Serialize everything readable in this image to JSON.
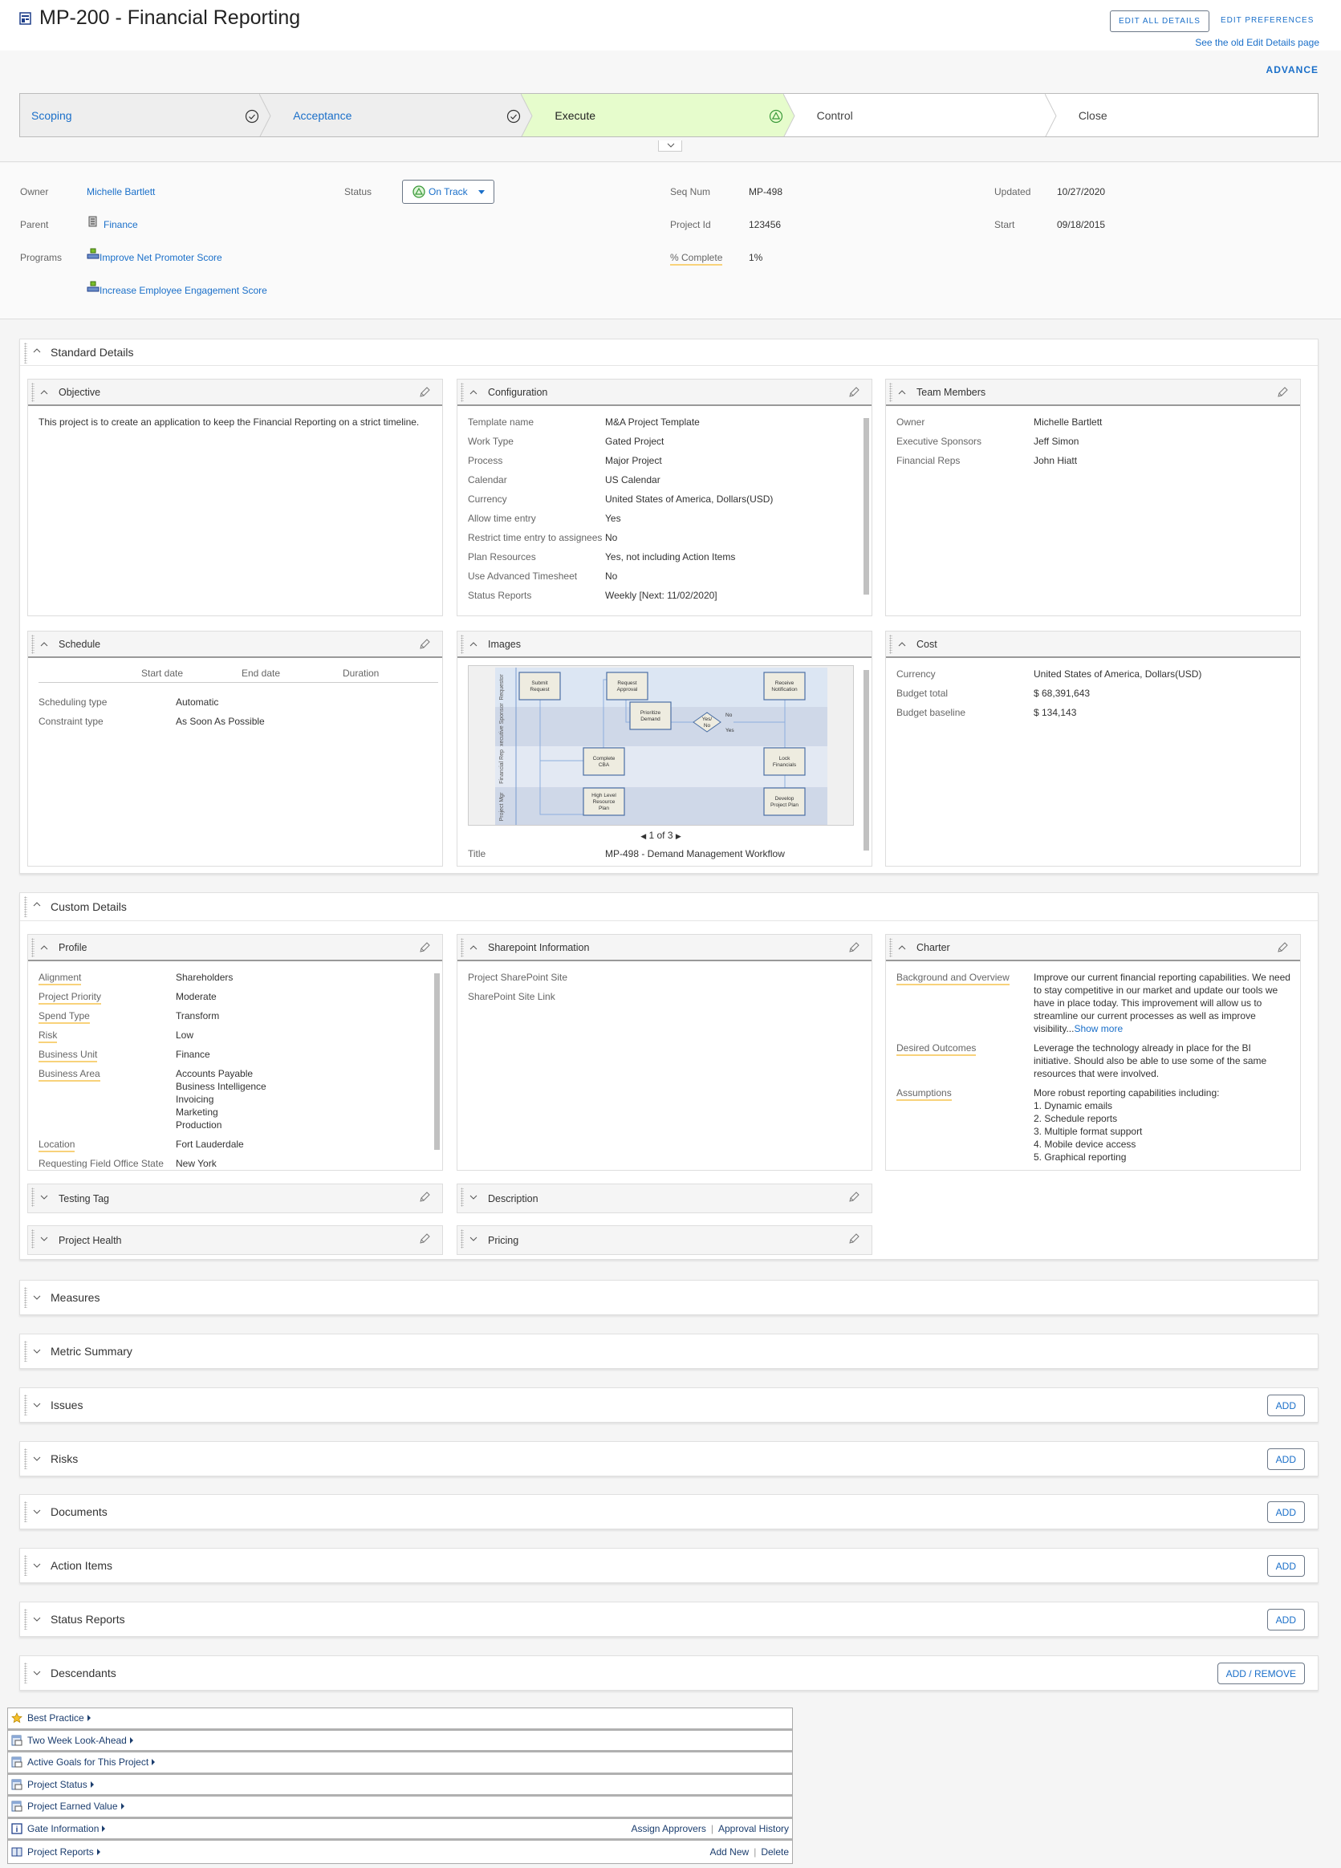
{
  "header": {
    "title": "MP-200 - Financial Reporting",
    "edit_all": "EDIT ALL DETAILS",
    "edit_prefs": "EDIT PREFERENCES",
    "old_page": "See the old Edit Details page",
    "advance": "ADVANCE"
  },
  "stages": [
    {
      "label": "Scoping",
      "state": "complete"
    },
    {
      "label": "Acceptance",
      "state": "complete"
    },
    {
      "label": "Execute",
      "state": "current"
    },
    {
      "label": "Control",
      "state": "future"
    },
    {
      "label": "Close",
      "state": "future"
    }
  ],
  "info": {
    "owner_label": "Owner",
    "owner": "Michelle Bartlett",
    "parent_label": "Parent",
    "parent": "Finance",
    "programs_label": "Programs",
    "programs": [
      "Improve Net Promoter Score",
      "Increase Employee Engagement Score"
    ],
    "status_label": "Status",
    "status": "On Track",
    "seq_label": "Seq Num",
    "seq": "MP-498",
    "projid_label": "Project Id",
    "projid": "123456",
    "pct_label": "% Complete",
    "pct": "1%",
    "updated_label": "Updated",
    "updated": "10/27/2020",
    "start_label": "Start",
    "start": "09/18/2015"
  },
  "standard": {
    "title": "Standard Details",
    "objective": {
      "title": "Objective",
      "text": "This project is to create an application to keep the Financial Reporting on a strict timeline."
    },
    "configuration": {
      "title": "Configuration",
      "rows": [
        {
          "k": "Template name",
          "v": "M&A Project Template"
        },
        {
          "k": "Work Type",
          "v": "Gated Project"
        },
        {
          "k": "Process",
          "v": "Major Project"
        },
        {
          "k": "Calendar",
          "v": "US Calendar",
          "link": true
        },
        {
          "k": "Currency",
          "v": "United States of America, Dollars(USD)"
        },
        {
          "k": "Allow time entry",
          "v": "Yes"
        },
        {
          "k": "Restrict time entry to assignees",
          "v": "No"
        },
        {
          "k": "Plan Resources",
          "v": "Yes, not including Action Items"
        },
        {
          "k": "Use Advanced Timesheet",
          "v": "No"
        },
        {
          "k": "Status Reports",
          "v": "Weekly [Next: 11/02/2020]"
        }
      ]
    },
    "team": {
      "title": "Team Members",
      "rows": [
        {
          "k": "Owner",
          "v": "Michelle Bartlett",
          "link": true
        },
        {
          "k": "Executive Sponsors",
          "v": "Jeff Simon",
          "link": true
        },
        {
          "k": "Financial Reps",
          "v": "John Hiatt",
          "link": true
        }
      ]
    },
    "schedule": {
      "title": "Schedule",
      "columns": [
        "Start date",
        "End date",
        "Duration"
      ],
      "rows": [
        {
          "k": "Scheduling type",
          "v": "Automatic"
        },
        {
          "k": "Constraint type",
          "v": "As Soon As Possible"
        }
      ]
    },
    "images": {
      "title": "Images",
      "pager": "1 of 3",
      "title_label": "Title",
      "title_value": "MP-498 - Demand Management Workflow",
      "lanes": [
        "Requestor",
        "Executive Sponsor",
        "Financial Rep",
        "Project Mgr"
      ],
      "nodes": [
        "Submit Request",
        "Request Approval",
        "Receive Notification",
        "Prioritize Demand",
        "Yes/ No",
        "Complete CBA",
        "Lock Financials",
        "High Level Resource Plan",
        "Develop Project Plan"
      ],
      "edge_labels": [
        "No",
        "Yes"
      ]
    },
    "cost": {
      "title": "Cost",
      "rows": [
        {
          "k": "Currency",
          "v": "United States of America, Dollars(USD)"
        },
        {
          "k": "Budget total",
          "v": "$ 68,391,643"
        },
        {
          "k": "Budget baseline",
          "v": "$ 134,143"
        }
      ]
    }
  },
  "custom": {
    "title": "Custom Details",
    "profile": {
      "title": "Profile",
      "rows": [
        {
          "k": "Alignment",
          "v": "Shareholders",
          "u": true
        },
        {
          "k": "Project Priority",
          "v": "Moderate",
          "u": true
        },
        {
          "k": "Spend Type",
          "v": "Transform",
          "u": true
        },
        {
          "k": "Risk",
          "v": "Low",
          "u": true
        },
        {
          "k": "Business Unit",
          "v": "Finance",
          "u": true
        },
        {
          "k": "Business Area",
          "v": "Accounts Payable\nBusiness Intelligence\nInvoicing\nMarketing\nProduction",
          "u": true
        },
        {
          "k": "Location",
          "v": "Fort Lauderdale",
          "u": true
        },
        {
          "k": "Requesting Field Office State",
          "v": "New York"
        }
      ]
    },
    "sharepoint": {
      "title": "Sharepoint Information",
      "rows": [
        {
          "k": "Project SharePoint Site",
          "v": ""
        },
        {
          "k": "SharePoint Site Link",
          "v": ""
        }
      ]
    },
    "charter": {
      "title": "Charter",
      "show_more": "Show more",
      "rows": [
        {
          "k": "Background and Overview",
          "v": "Improve our current financial reporting capabilities. We need to stay competitive in our market and update our tools we have in place today. This improvement will allow us to streamline our current processes as well as improve visibility...",
          "u": true,
          "more": true
        },
        {
          "k": "Desired Outcomes",
          "v": "Leverage the technology already in place for the BI initiative. Should also be able to use some of the same resources that were involved.",
          "u": true
        },
        {
          "k": "Assumptions",
          "v": "More robust reporting capabilities including:\n1. Dynamic emails\n2. Schedule reports\n3. Multiple format support\n4. Mobile device access\n5. Graphical reporting",
          "u": true
        }
      ]
    },
    "collapsed": [
      "Testing Tag",
      "Description",
      "Project Health",
      "Pricing"
    ]
  },
  "sections": [
    {
      "title": "Measures"
    },
    {
      "title": "Metric Summary"
    },
    {
      "title": "Issues",
      "button": "ADD"
    },
    {
      "title": "Risks",
      "button": "ADD"
    },
    {
      "title": "Documents",
      "button": "ADD"
    },
    {
      "title": "Action Items",
      "button": "ADD"
    },
    {
      "title": "Status Reports",
      "button": "ADD"
    },
    {
      "title": "Descendants",
      "button": "ADD / REMOVE"
    }
  ],
  "bottom": [
    {
      "label": "Best Practice",
      "icon": "star-icon"
    },
    {
      "label": "Two Week Look-Ahead",
      "icon": "report-icon"
    },
    {
      "label": "Active Goals for This Project",
      "icon": "report-icon"
    },
    {
      "label": "Project Status",
      "icon": "report-icon"
    },
    {
      "label": "Project Earned Value",
      "icon": "report-icon"
    },
    {
      "label": "Gate Information",
      "icon": "info-icon",
      "actions": [
        "Assign Approvers",
        "Approval History"
      ]
    },
    {
      "label": "Project Reports",
      "icon": "book-icon",
      "actions": [
        "Add New",
        "Delete"
      ]
    }
  ],
  "colors": {
    "link": "#1a6fc9",
    "current_stage": "#e6fccc",
    "complete_stage": "#eeeeee",
    "on_track": "#3a9a3a",
    "underline": "#f8d27a"
  }
}
